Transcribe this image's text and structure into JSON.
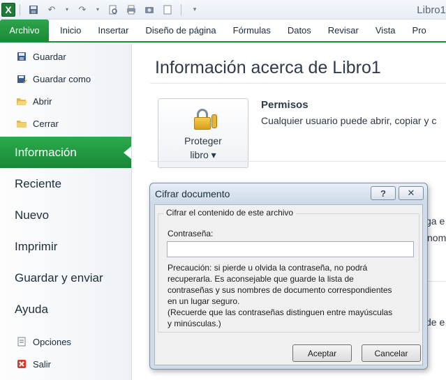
{
  "window": {
    "title": "Libro1"
  },
  "qat": {
    "logo": "X",
    "icons": [
      "save-icon",
      "undo-icon",
      "redo-icon",
      "print-preview-icon",
      "print-icon",
      "camera-icon",
      "new-doc-icon",
      "customize-icon"
    ]
  },
  "tabs": [
    "Archivo",
    "Inicio",
    "Insertar",
    "Diseño de página",
    "Fórmulas",
    "Datos",
    "Revisar",
    "Vista",
    "Pro"
  ],
  "sidebar": {
    "top_items": [
      "Guardar",
      "Guardar como",
      "Abrir",
      "Cerrar"
    ],
    "big_items": [
      "Información",
      "Reciente",
      "Nuevo",
      "Imprimir",
      "Guardar y enviar",
      "Ayuda"
    ],
    "bottom_items": [
      "Opciones",
      "Salir"
    ]
  },
  "main": {
    "title": "Información acerca de Libro1",
    "protect_button": {
      "line1": "Proteger",
      "line2": "libro ▾"
    },
    "permissions_title": "Permisos",
    "permissions_text": "Cualquier usuario puede abrir, copiar y c",
    "fragment1": "ga e",
    "fragment2": "nom",
    "fragment3": "de e"
  },
  "dialog": {
    "title": "Cifrar documento",
    "help": "?",
    "close": "✕",
    "group_label": "Cifrar el contenido de este archivo",
    "password_label": "Contraseña:",
    "password_value": "",
    "warning_lines": [
      "Precaución: si pierde u olvida la contraseña, no podrá",
      "recuperarla. Es aconsejable que guarde la lista de",
      "contraseñas y sus nombres de documento correspondientes",
      "en un lugar seguro.",
      "(Recuerde que las contraseñas distinguen entre mayúsculas",
      "y minúsculas.)"
    ],
    "ok": "Aceptar",
    "cancel": "Cancelar"
  },
  "colors": {
    "accent": "#1f8c3b",
    "dialog_frame": "#cfdbe8"
  }
}
